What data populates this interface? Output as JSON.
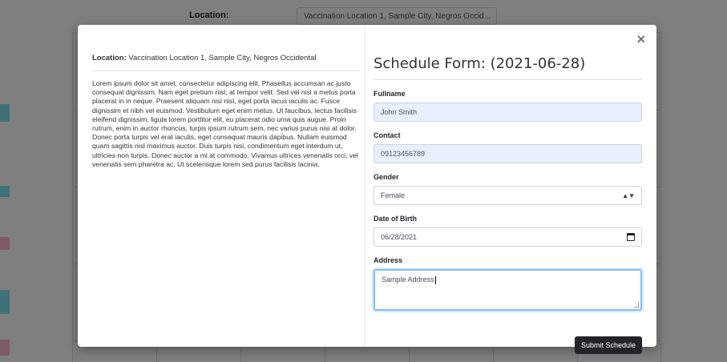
{
  "background": {
    "location_label": "Location:",
    "location_select_value": "Vaccination Location 1, Sample City, Negros Occid..."
  },
  "modal": {
    "close_symbol": "×",
    "location_label": "Location:",
    "location_value": "Vaccination Location 1, Sample City, Negros Occidental",
    "description": "Lorem ipsum dolor sit amet, consectetur adipiscing elit. Phasellus accumsan ac justo consequat dignissim. Nam eget pretium nisl, at tempor velit. Sed vel nisl a metus porta placerat in in neque. Praesent aliquam nisi nisl, eget porta lacus iaculis ac. Fusce dignissim et nibh vel euismod. Vestibulum eget enim metus. Ut faucibus, lectus facilisis eleifend dignissim, ligula lorem porttitor elit, eu placerat odio urna quis augue. Proin rutrum, enim in auctor rhoncus, turpis ipsum rutrum sem, nec varius purus nisi at dolor. Donec porta turpis vel erat iaculis, eget consequat mauris dapibus. Nullam euismod quam sagittis nisl maximus auctor. Duis turpis nisi, condimentum eget interdum ut, ultricies non turpis. Donec auctor a mi at commodo. Vivamus ultrices venenatis orci, vel venenatis sem pharetra ac. Ut scelerisque lorem sed purus facilisis lacinia.",
    "form": {
      "title": "Schedule Form: (2021-06-28)",
      "fullname_label": "Fullname",
      "fullname_value": "John Smith",
      "contact_label": "Contact",
      "contact_value": "09123456789",
      "gender_label": "Gender",
      "gender_value": "Female",
      "dob_label": "Date of Birth",
      "dob_value": "06/28/2021",
      "address_label": "Address",
      "address_value": "Sample Address",
      "submit_label": "Submit Schedule"
    }
  },
  "colors": {
    "backdrop": "#000000",
    "autofill": "#e8f0fe",
    "focus_border": "#80bdff",
    "button": "#212529"
  }
}
